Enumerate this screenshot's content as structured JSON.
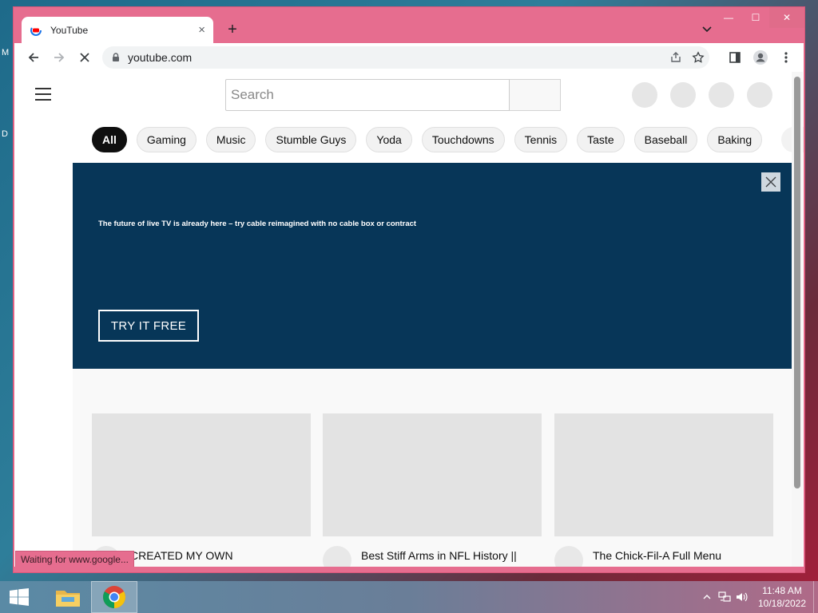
{
  "desktop": {
    "letters": [
      "M",
      "D"
    ]
  },
  "window": {
    "controls": {
      "minimize": "—",
      "maximize": "☐",
      "close": "✕"
    }
  },
  "tab": {
    "title": "YouTube",
    "close_icon": "×"
  },
  "new_tab_icon": "+",
  "toolbar": {
    "url": "youtube.com"
  },
  "page": {
    "search_placeholder": "Search",
    "chips": [
      "All",
      "Gaming",
      "Music",
      "Stumble Guys",
      "Yoda",
      "Touchdowns",
      "Tennis",
      "Taste",
      "Baseball",
      "Baking"
    ],
    "active_chip": "All",
    "banner": {
      "text": "The future of live TV is already here – try cable reimagined with no cable box or contract",
      "cta": "TRY IT FREE"
    },
    "videos": [
      {
        "title": "CREATED MY OWN"
      },
      {
        "title": "Best Stiff Arms in NFL History ||"
      },
      {
        "title": "The Chick-Fil-A Full Menu"
      }
    ]
  },
  "status_bar": "Waiting for www.google...",
  "taskbar": {
    "time": "11:48 AM",
    "date": "10/18/2022"
  },
  "colors": {
    "window_frame": "#e66d8f",
    "banner_bg": "#073658",
    "active_chip": "#0f0f0f"
  }
}
